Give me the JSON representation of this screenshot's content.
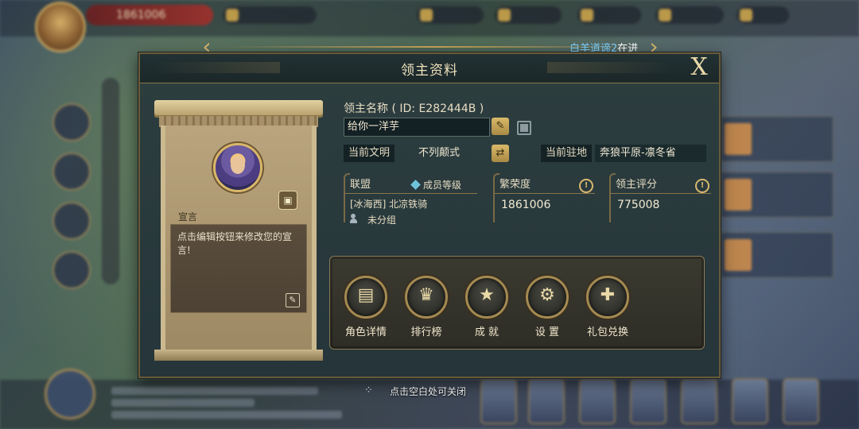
{
  "hud": {
    "power": "1861006"
  },
  "nav": {
    "event_name": "白羊道谛",
    "event_num": "2",
    "event_suffix": "在进"
  },
  "dialog": {
    "title": "领主资料",
    "close_label": "X"
  },
  "profile": {
    "declaration_label": "宣言",
    "declaration_text": "点击编辑按钮来修改您的宣言!",
    "name_label": "领主名称 ( ID: E282444B )",
    "name_value": "给你一洋芋",
    "civ_label": "当前文明",
    "civ_value": "不列颠式",
    "seat_label": "当前驻地",
    "seat_value": "奔狼平原-凛冬省"
  },
  "stats": {
    "alliance": {
      "label": "联盟",
      "member_level_label": "成员等级",
      "name": "[冰海西] 北凉铁骑",
      "group": "未分组"
    },
    "prosperity": {
      "label": "繁荣度",
      "value": "1861006"
    },
    "score": {
      "label": "领主评分",
      "value": "775008"
    }
  },
  "functions": [
    {
      "label": "角色详情",
      "icon": "cards-icon"
    },
    {
      "label": "排行榜",
      "icon": "trophy-icon"
    },
    {
      "label": "成 就",
      "icon": "star-badge-icon"
    },
    {
      "label": "设 置",
      "icon": "gear-icon"
    },
    {
      "label": "礼包兑换",
      "icon": "gift-icon"
    }
  ],
  "footer": {
    "close_hint": "点击空白处可关闭"
  },
  "colors": {
    "accent_gold": "#d9b968",
    "panel_bg": "#2d3e3f",
    "nav_text": "#7fd3ff"
  }
}
